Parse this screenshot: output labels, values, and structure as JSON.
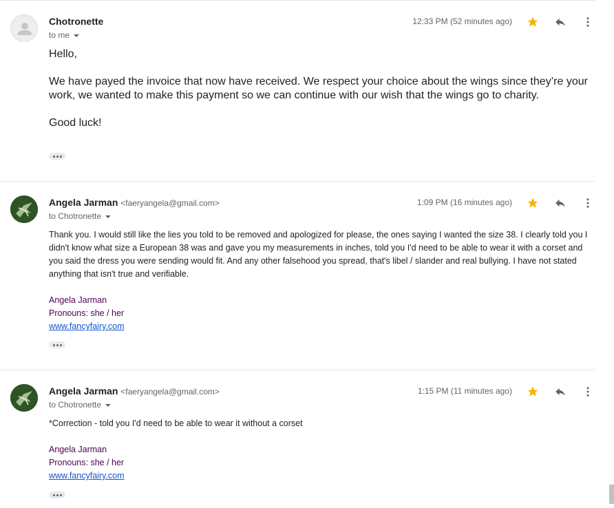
{
  "messages": [
    {
      "sender": "Chotronette",
      "email": "",
      "to_label": "to me",
      "time": "12:33 PM (52 minutes ago)",
      "starred": true,
      "avatar": "default-person-icon",
      "body": [
        "Hello,",
        "We have payed the invoice that now have received. We respect your choice about the wings since they’re your work, we wanted to make this payment so we can continue with our wish that the wings go to charity.",
        "Good luck!"
      ]
    },
    {
      "sender": "Angela Jarman",
      "email": "<faeryangela@gmail.com>",
      "to_label": "to Chotronette",
      "time": "1:09 PM (16 minutes ago)",
      "starred": true,
      "avatar": "fairy-art-avatar",
      "body": [
        "Thank you. I would still like the lies you told to be removed and apologized for please, the ones saying I wanted the size 38. I clearly told you I didn't know what size a European 38 was and gave you my measurements in inches, told you I'd need to be able to wear it with a corset and you said the dress you were sending would fit. And any other falsehood you spread, that's libel / slander and real bullying. I have not stated anything that isn't true and verifiable."
      ],
      "signature": {
        "name": "Angela Jarman",
        "pronouns": "Pronouns: she / her",
        "link": "www.fancyfairy.com"
      }
    },
    {
      "sender": "Angela Jarman",
      "email": "<faeryangela@gmail.com>",
      "to_label": "to Chotronette",
      "time": "1:15 PM (11 minutes ago)",
      "starred": true,
      "avatar": "fairy-art-avatar",
      "body": [
        "*Correction - told you I'd need to be able to wear it without a corset"
      ],
      "signature": {
        "name": "Angela Jarman",
        "pronouns": "Pronouns: she / her",
        "link": "www.fancyfairy.com"
      }
    }
  ],
  "colors": {
    "star": "#f4b400",
    "link": "#1155cc",
    "signature": "#500050"
  }
}
